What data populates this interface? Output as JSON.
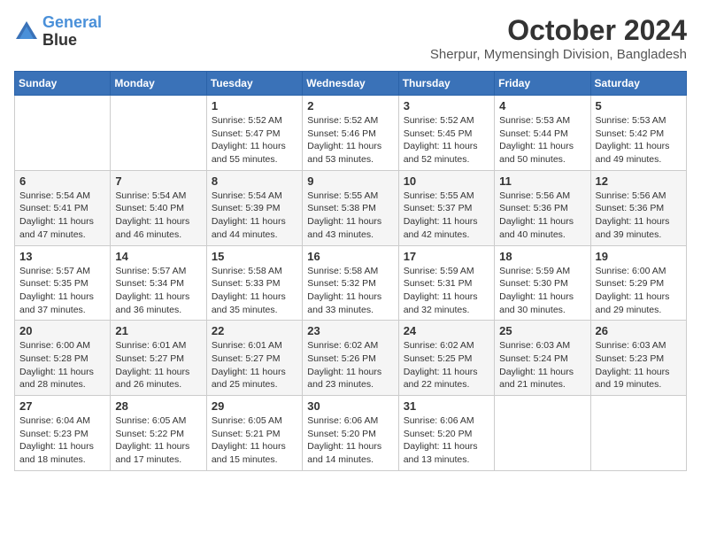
{
  "logo": {
    "line1": "General",
    "line2": "Blue"
  },
  "title": "October 2024",
  "subtitle": "Sherpur, Mymensingh Division, Bangladesh",
  "header": {
    "days": [
      "Sunday",
      "Monday",
      "Tuesday",
      "Wednesday",
      "Thursday",
      "Friday",
      "Saturday"
    ]
  },
  "weeks": [
    {
      "cells": [
        {
          "day": null,
          "sunrise": null,
          "sunset": null,
          "daylight": null
        },
        {
          "day": null,
          "sunrise": null,
          "sunset": null,
          "daylight": null
        },
        {
          "day": "1",
          "sunrise": "Sunrise: 5:52 AM",
          "sunset": "Sunset: 5:47 PM",
          "daylight": "Daylight: 11 hours and 55 minutes."
        },
        {
          "day": "2",
          "sunrise": "Sunrise: 5:52 AM",
          "sunset": "Sunset: 5:46 PM",
          "daylight": "Daylight: 11 hours and 53 minutes."
        },
        {
          "day": "3",
          "sunrise": "Sunrise: 5:52 AM",
          "sunset": "Sunset: 5:45 PM",
          "daylight": "Daylight: 11 hours and 52 minutes."
        },
        {
          "day": "4",
          "sunrise": "Sunrise: 5:53 AM",
          "sunset": "Sunset: 5:44 PM",
          "daylight": "Daylight: 11 hours and 50 minutes."
        },
        {
          "day": "5",
          "sunrise": "Sunrise: 5:53 AM",
          "sunset": "Sunset: 5:42 PM",
          "daylight": "Daylight: 11 hours and 49 minutes."
        }
      ]
    },
    {
      "cells": [
        {
          "day": "6",
          "sunrise": "Sunrise: 5:54 AM",
          "sunset": "Sunset: 5:41 PM",
          "daylight": "Daylight: 11 hours and 47 minutes."
        },
        {
          "day": "7",
          "sunrise": "Sunrise: 5:54 AM",
          "sunset": "Sunset: 5:40 PM",
          "daylight": "Daylight: 11 hours and 46 minutes."
        },
        {
          "day": "8",
          "sunrise": "Sunrise: 5:54 AM",
          "sunset": "Sunset: 5:39 PM",
          "daylight": "Daylight: 11 hours and 44 minutes."
        },
        {
          "day": "9",
          "sunrise": "Sunrise: 5:55 AM",
          "sunset": "Sunset: 5:38 PM",
          "daylight": "Daylight: 11 hours and 43 minutes."
        },
        {
          "day": "10",
          "sunrise": "Sunrise: 5:55 AM",
          "sunset": "Sunset: 5:37 PM",
          "daylight": "Daylight: 11 hours and 42 minutes."
        },
        {
          "day": "11",
          "sunrise": "Sunrise: 5:56 AM",
          "sunset": "Sunset: 5:36 PM",
          "daylight": "Daylight: 11 hours and 40 minutes."
        },
        {
          "day": "12",
          "sunrise": "Sunrise: 5:56 AM",
          "sunset": "Sunset: 5:36 PM",
          "daylight": "Daylight: 11 hours and 39 minutes."
        }
      ]
    },
    {
      "cells": [
        {
          "day": "13",
          "sunrise": "Sunrise: 5:57 AM",
          "sunset": "Sunset: 5:35 PM",
          "daylight": "Daylight: 11 hours and 37 minutes."
        },
        {
          "day": "14",
          "sunrise": "Sunrise: 5:57 AM",
          "sunset": "Sunset: 5:34 PM",
          "daylight": "Daylight: 11 hours and 36 minutes."
        },
        {
          "day": "15",
          "sunrise": "Sunrise: 5:58 AM",
          "sunset": "Sunset: 5:33 PM",
          "daylight": "Daylight: 11 hours and 35 minutes."
        },
        {
          "day": "16",
          "sunrise": "Sunrise: 5:58 AM",
          "sunset": "Sunset: 5:32 PM",
          "daylight": "Daylight: 11 hours and 33 minutes."
        },
        {
          "day": "17",
          "sunrise": "Sunrise: 5:59 AM",
          "sunset": "Sunset: 5:31 PM",
          "daylight": "Daylight: 11 hours and 32 minutes."
        },
        {
          "day": "18",
          "sunrise": "Sunrise: 5:59 AM",
          "sunset": "Sunset: 5:30 PM",
          "daylight": "Daylight: 11 hours and 30 minutes."
        },
        {
          "day": "19",
          "sunrise": "Sunrise: 6:00 AM",
          "sunset": "Sunset: 5:29 PM",
          "daylight": "Daylight: 11 hours and 29 minutes."
        }
      ]
    },
    {
      "cells": [
        {
          "day": "20",
          "sunrise": "Sunrise: 6:00 AM",
          "sunset": "Sunset: 5:28 PM",
          "daylight": "Daylight: 11 hours and 28 minutes."
        },
        {
          "day": "21",
          "sunrise": "Sunrise: 6:01 AM",
          "sunset": "Sunset: 5:27 PM",
          "daylight": "Daylight: 11 hours and 26 minutes."
        },
        {
          "day": "22",
          "sunrise": "Sunrise: 6:01 AM",
          "sunset": "Sunset: 5:27 PM",
          "daylight": "Daylight: 11 hours and 25 minutes."
        },
        {
          "day": "23",
          "sunrise": "Sunrise: 6:02 AM",
          "sunset": "Sunset: 5:26 PM",
          "daylight": "Daylight: 11 hours and 23 minutes."
        },
        {
          "day": "24",
          "sunrise": "Sunrise: 6:02 AM",
          "sunset": "Sunset: 5:25 PM",
          "daylight": "Daylight: 11 hours and 22 minutes."
        },
        {
          "day": "25",
          "sunrise": "Sunrise: 6:03 AM",
          "sunset": "Sunset: 5:24 PM",
          "daylight": "Daylight: 11 hours and 21 minutes."
        },
        {
          "day": "26",
          "sunrise": "Sunrise: 6:03 AM",
          "sunset": "Sunset: 5:23 PM",
          "daylight": "Daylight: 11 hours and 19 minutes."
        }
      ]
    },
    {
      "cells": [
        {
          "day": "27",
          "sunrise": "Sunrise: 6:04 AM",
          "sunset": "Sunset: 5:23 PM",
          "daylight": "Daylight: 11 hours and 18 minutes."
        },
        {
          "day": "28",
          "sunrise": "Sunrise: 6:05 AM",
          "sunset": "Sunset: 5:22 PM",
          "daylight": "Daylight: 11 hours and 17 minutes."
        },
        {
          "day": "29",
          "sunrise": "Sunrise: 6:05 AM",
          "sunset": "Sunset: 5:21 PM",
          "daylight": "Daylight: 11 hours and 15 minutes."
        },
        {
          "day": "30",
          "sunrise": "Sunrise: 6:06 AM",
          "sunset": "Sunset: 5:20 PM",
          "daylight": "Daylight: 11 hours and 14 minutes."
        },
        {
          "day": "31",
          "sunrise": "Sunrise: 6:06 AM",
          "sunset": "Sunset: 5:20 PM",
          "daylight": "Daylight: 11 hours and 13 minutes."
        },
        {
          "day": null,
          "sunrise": null,
          "sunset": null,
          "daylight": null
        },
        {
          "day": null,
          "sunrise": null,
          "sunset": null,
          "daylight": null
        }
      ]
    }
  ]
}
